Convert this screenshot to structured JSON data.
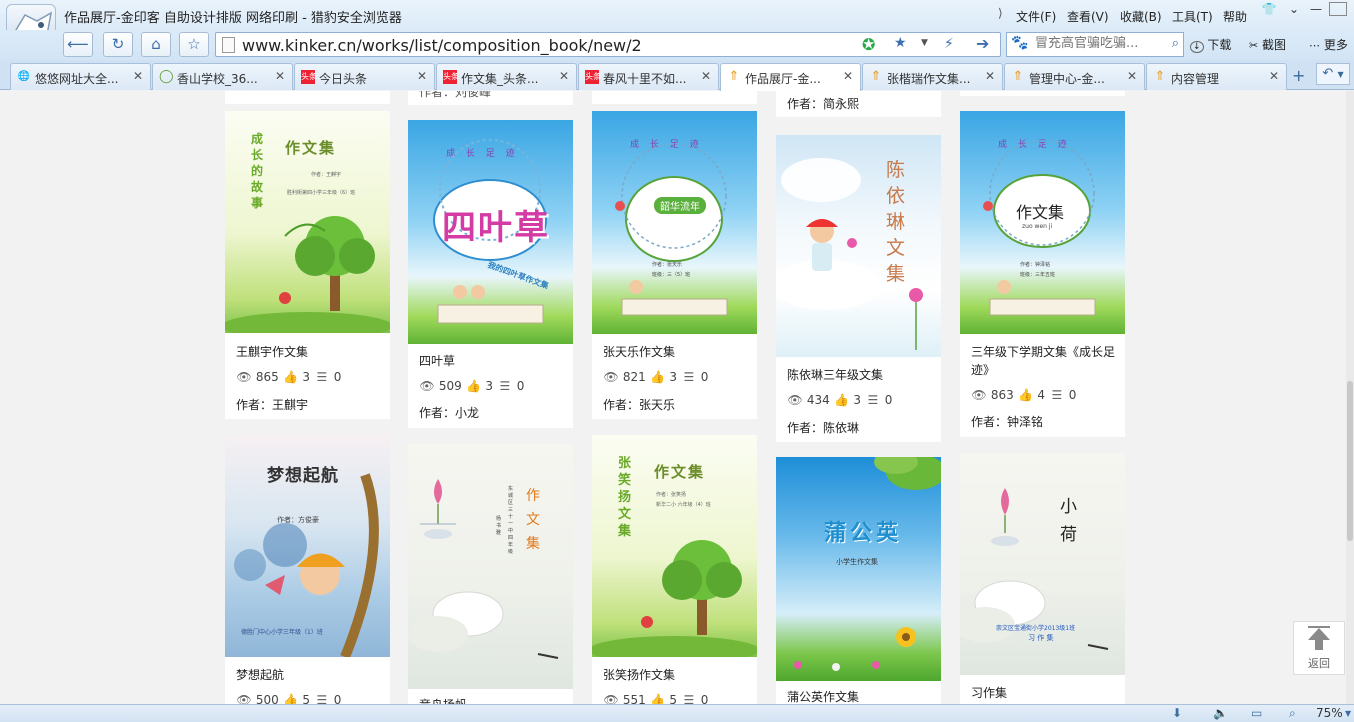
{
  "browser": {
    "window_title": "作品展厅-金印客 自助设计排版 网络印刷 - 猎豹安全浏览器",
    "menu": [
      "文件(F)",
      "查看(V)",
      "收藏(B)",
      "工具(T)",
      "帮助"
    ],
    "url": "www.kinker.cn/works/list/composition_book/new/2",
    "search_placeholder": "冒充高官骗吃骗...",
    "download_label": "下载",
    "screenshot_label": "截图",
    "more_label": "更多",
    "tabs": [
      {
        "label": "悠悠网址大全...",
        "icon": "globe-icon"
      },
      {
        "label": "香山学校_36...",
        "icon": "search-engine-icon"
      },
      {
        "label": "今日头条",
        "icon": "toutiao-icon",
        "badge": "头条"
      },
      {
        "label": "作文集_头条...",
        "icon": "toutiao-icon",
        "badge": "头条"
      },
      {
        "label": "春风十里不如...",
        "icon": "toutiao-icon",
        "badge": "头条"
      },
      {
        "label": "作品展厅-金...",
        "icon": "kinker-icon"
      },
      {
        "label": "张楷瑞作文集...",
        "icon": "kinker-icon"
      },
      {
        "label": "管理中心-金...",
        "icon": "kinker-icon"
      },
      {
        "label": "内容管理",
        "icon": "kinker-icon"
      }
    ],
    "zoom": "75%"
  },
  "top_fragments": {
    "col2_author": "作者：刘俊峰",
    "col4_author": "作者：简永熙"
  },
  "cards": [
    {
      "title": "王麒宇作文集",
      "views": "865",
      "likes": "3",
      "comments": "0",
      "author": "作者：王麒宇",
      "cover": {
        "heading": "作文集",
        "side": "成长的故事",
        "sub1": "作者：王麒宇",
        "sub2": "胜利街第四小学三年级（6）班"
      }
    },
    {
      "title": "四叶草",
      "views": "509",
      "likes": "3",
      "comments": "0",
      "author": "作者：小龙",
      "cover": {
        "heading": "四叶草",
        "top": "成 长 足 迹",
        "sub1": "我的四叶草作文集"
      }
    },
    {
      "title": "张天乐作文集",
      "views": "821",
      "likes": "3",
      "comments": "0",
      "author": "作者：张天乐",
      "cover": {
        "heading": "韶华流年",
        "top": "成 长 足 迹",
        "sub1": "作者：张天乐",
        "sub2": "班级：三（5）班"
      }
    },
    {
      "title": "陈依琳三年级文集",
      "views": "434",
      "likes": "3",
      "comments": "0",
      "author": "作者：陈依琳",
      "cover": {
        "heading": "陈依琳文集"
      }
    },
    {
      "title": "三年级下学期文集《成长足迹》",
      "views": "863",
      "likes": "4",
      "comments": "0",
      "author": "作者：钟泽铭",
      "cover": {
        "heading": "作文集",
        "top": "成 长 足 迹",
        "sub1": "zuo wen ji",
        "sub2": "作者：钟泽铭",
        "sub3": "班级：三年五班"
      }
    },
    {
      "title": "梦想起航",
      "views": "500",
      "likes": "5",
      "comments": "0",
      "author": "",
      "cover": {
        "heading": "梦想起航",
        "sub1": "作者：方俊豪",
        "sub2": "德胜门中心小学三年级（1）班"
      }
    },
    {
      "title": "竞舟扬帆",
      "views": "",
      "likes": "",
      "comments": "",
      "author": "",
      "cover": {
        "heading": "作文集",
        "sub1": "东城区三十一中四年级",
        "sub2": "杨书雅"
      }
    },
    {
      "title": "张笑扬作文集",
      "views": "551",
      "likes": "5",
      "comments": "0",
      "author": "",
      "cover": {
        "heading": "作文集",
        "side": "张笑扬文集",
        "sub1": "作者：张笑扬",
        "sub2": "新华二小 六年级（4）班"
      }
    },
    {
      "title": "蒲公英作文集",
      "views": "",
      "likes": "",
      "comments": "",
      "author": "",
      "cover": {
        "heading": "蒲公英",
        "sub1": "小学生作文集"
      }
    },
    {
      "title": "习作集",
      "views": "",
      "likes": "",
      "comments": "",
      "author": "",
      "cover": {
        "heading": "小荷",
        "sub1": "崇文区宝通街小学2013级1班",
        "sub2": "习 作 集"
      }
    }
  ],
  "back_to_top_label": "返回"
}
